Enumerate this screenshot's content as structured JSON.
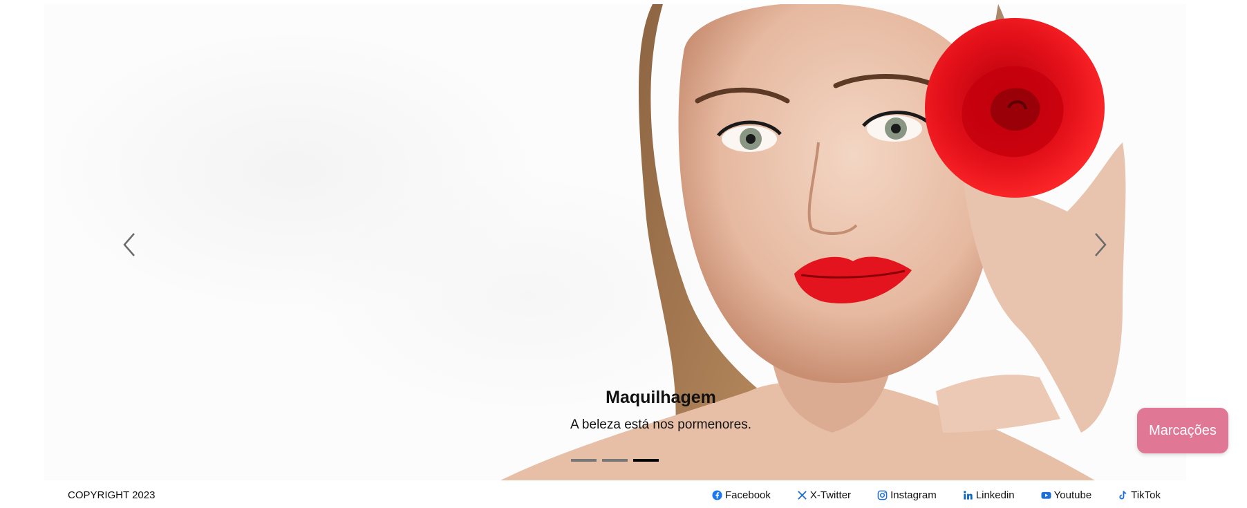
{
  "carousel": {
    "caption_title": "Maquilhagem",
    "caption_subtitle": "A beleza está nos pormenores.",
    "slide_count": 3,
    "active_slide": 3
  },
  "booking_button": {
    "label": "Marcações",
    "color": "#e07795"
  },
  "footer": {
    "copyright": "COPYRIGHT 2023",
    "social": [
      {
        "label": "Facebook",
        "icon": "facebook-icon",
        "color": "#1877f2"
      },
      {
        "label": "X-Twitter",
        "icon": "x-twitter-icon",
        "color": "#1d6fd6"
      },
      {
        "label": "Instagram",
        "icon": "instagram-icon",
        "color": "#1d6fd6"
      },
      {
        "label": "Linkedin",
        "icon": "linkedin-icon",
        "color": "#0a66c2"
      },
      {
        "label": "Youtube",
        "icon": "youtube-icon",
        "color": "#1d6fd6"
      },
      {
        "label": "TikTok",
        "icon": "tiktok-icon",
        "color": "#1d6fd6"
      }
    ]
  }
}
